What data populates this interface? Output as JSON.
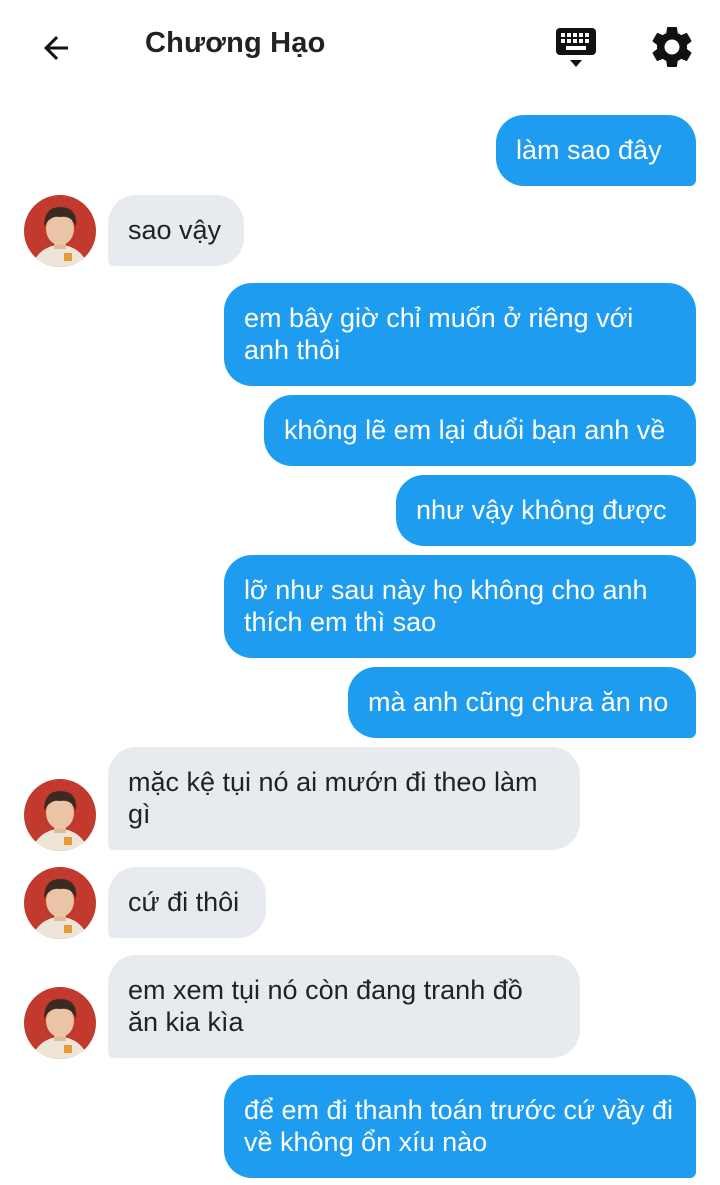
{
  "header": {
    "title": "Chương Hạo",
    "back_icon": "arrow-left-icon",
    "keyboard_icon": "keyboard-icon",
    "settings_icon": "gear-icon"
  },
  "colors": {
    "sent_bubble": "#1e9cf0",
    "received_bubble": "#e7ebef",
    "sent_text": "#ffffff",
    "received_text": "#222222"
  },
  "messages": [
    {
      "from": "me",
      "text": "làm sao đây"
    },
    {
      "from": "contact",
      "text": "sao vậy"
    },
    {
      "from": "me",
      "text": "em bây giờ chỉ muốn ở riêng với anh thôi"
    },
    {
      "from": "me",
      "text": "không lẽ em lại đuổi bạn anh về"
    },
    {
      "from": "me",
      "text": "như vậy không được"
    },
    {
      "from": "me",
      "text": "lỡ như sau này họ không cho anh thích em thì sao"
    },
    {
      "from": "me",
      "text": "mà anh cũng chưa ăn no"
    },
    {
      "from": "contact",
      "text": "mặc kệ tụi nó ai mướn đi theo làm gì"
    },
    {
      "from": "contact",
      "text": "cứ đi thôi"
    },
    {
      "from": "contact",
      "text": "em xem tụi nó còn đang tranh đồ ăn kia kìa"
    },
    {
      "from": "me",
      "text": "để em đi thanh toán trước cứ vầy đi về không ổn xíu nào"
    }
  ]
}
